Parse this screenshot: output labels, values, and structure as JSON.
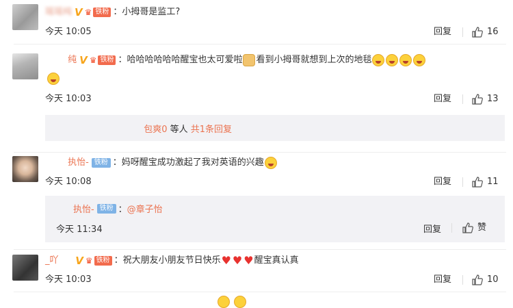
{
  "comments": [
    {
      "username": "瑶瑶纯",
      "fan_badge": "铁粉",
      "text": "：小拇哥是监工?",
      "time": "今天 10:05",
      "reply_label": "回复",
      "likes": "16"
    },
    {
      "username": "纯",
      "fan_badge": "铁粉",
      "text_a": "：哈哈哈哈哈哈醒宝也太可爱啦",
      "text_b": "看到小拇哥就想到上次的地毯",
      "time": "今天 10:03",
      "reply_label": "回复",
      "likes": "13",
      "sub_summary": {
        "names": "包爽0",
        "middle": " 等人 ",
        "count_link": "共1条回复"
      }
    },
    {
      "username": "执怡-",
      "fan_badge": "铁粉",
      "text": "：妈呀醒宝成功激起了我对英语的兴趣",
      "time": "今天 10:08",
      "reply_label": "回复",
      "likes": "11",
      "sub_reply": {
        "username": "执怡-",
        "fan_badge": "铁粉",
        "prefix": "：",
        "mention": "@章子怡",
        "time": "今天 11:34",
        "reply_label": "回复",
        "like_label": "赞"
      }
    },
    {
      "username": "_吖",
      "fan_badge": "铁粉",
      "text_a": "：祝大朋友小朋友节日快乐",
      "text_b": "醒宝真认真",
      "time": "今天 10:03",
      "reply_label": "回复",
      "likes": "10"
    }
  ],
  "icons": {
    "vip": "v-badge-icon",
    "crown": "crown-icon",
    "like": "thumbs-up-icon",
    "emoji_laugh": "laughing-emoji-icon",
    "emoji_doge": "doge-emoji-icon",
    "heart": "red-heart-icon"
  },
  "colors": {
    "username": "#eb7350",
    "tiefen_red": "#f26b4d",
    "tiefen_blue": "#7fb3e6",
    "sub_bg": "#f2f2f5"
  }
}
